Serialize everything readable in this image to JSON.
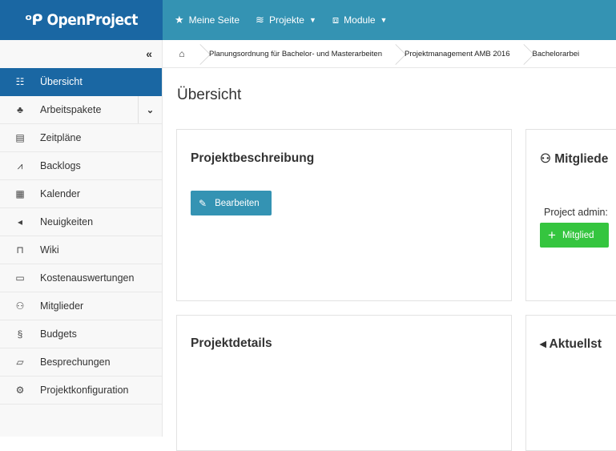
{
  "app": {
    "logo_mark": "ᵒᑭ",
    "logo_text": "OpenProject"
  },
  "topnav": [
    {
      "icon": "star-icon",
      "glyph": "★",
      "label": "Meine Seite",
      "caret": ""
    },
    {
      "icon": "layers-icon",
      "glyph": "≋",
      "label": "Projekte",
      "caret": "▼"
    },
    {
      "icon": "cube-icon",
      "glyph": "⧈",
      "label": "Module",
      "caret": "▼"
    }
  ],
  "sidebar": {
    "collapse_glyph": "«",
    "items": [
      {
        "glyph": "☷",
        "label": "Übersicht"
      },
      {
        "glyph": "♣",
        "label": "Arbeitspakete",
        "expand": "⌄"
      },
      {
        "glyph": "▤",
        "label": "Zeitpläne"
      },
      {
        "glyph": "⩘",
        "label": "Backlogs"
      },
      {
        "glyph": "▦",
        "label": "Kalender"
      },
      {
        "glyph": "◂",
        "label": "Neuigkeiten"
      },
      {
        "glyph": "⊓",
        "label": "Wiki"
      },
      {
        "glyph": "▭",
        "label": "Kostenauswertungen"
      },
      {
        "glyph": "⚇",
        "label": "Mitglieder"
      },
      {
        "glyph": "§",
        "label": "Budgets"
      },
      {
        "glyph": "▱",
        "label": "Besprechungen"
      },
      {
        "glyph": "⚙",
        "label": "Projektkonfiguration"
      }
    ]
  },
  "breadcrumb": {
    "home_glyph": "⌂",
    "items": [
      "Planungsordnung für Bachelor- und Masterarbeiten",
      "Projektmanagement AMB 2016",
      "Bachelorarbei"
    ]
  },
  "main": {
    "title": "Übersicht",
    "cards": {
      "beschreibung": {
        "title": "Projektbeschreibung",
        "button_glyph": "✎",
        "button_label": "Bearbeiten"
      },
      "mitglieder": {
        "title_glyph": "⚇",
        "title": "Mitgliede",
        "text": "Project admin:",
        "button_glyph": "+",
        "button_label": "Mitglied"
      },
      "details": {
        "title": "Projektdetails"
      },
      "aktuell": {
        "title_glyph": "◂",
        "title": "Aktuellst"
      }
    }
  }
}
